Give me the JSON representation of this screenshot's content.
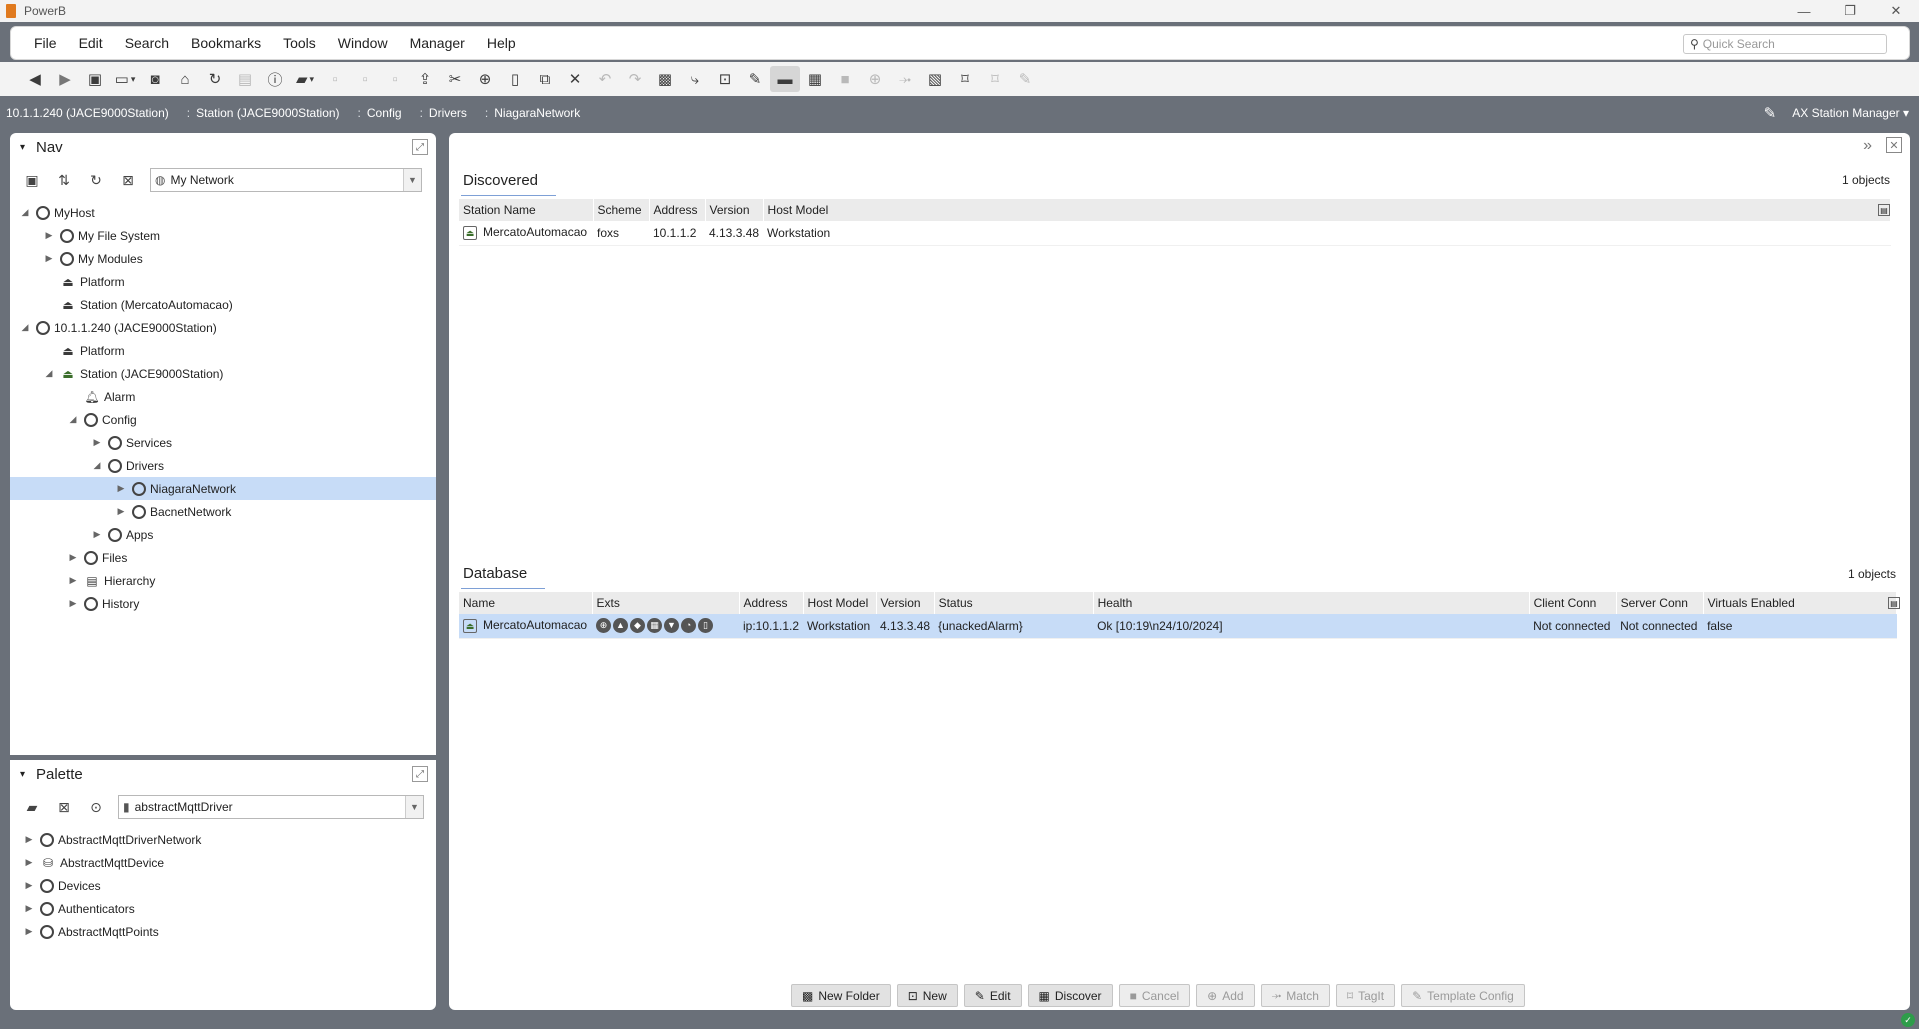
{
  "window": {
    "title": "PowerB",
    "minimize": "—",
    "restore": "❐",
    "close": "✕"
  },
  "menu": {
    "items": [
      "File",
      "Edit",
      "Search",
      "Bookmarks",
      "Tools",
      "Window",
      "Manager",
      "Help"
    ],
    "quick_search_placeholder": "Quick Search"
  },
  "pathbar": {
    "crumbs": [
      "10.1.1.240 (JACE9000Station)",
      "Station (JACE9000Station)",
      "Config",
      "Drivers",
      "NiagaraNetwork"
    ],
    "view_label": "AX Station Manager"
  },
  "nav": {
    "title": "Nav",
    "combo_value": "My Network",
    "tree": [
      {
        "label": "MyHost"
      },
      {
        "label": "My File System"
      },
      {
        "label": "My Modules"
      },
      {
        "label": "Platform"
      },
      {
        "label": "Station (MercatoAutomacao)"
      },
      {
        "label": "10.1.1.240 (JACE9000Station)"
      },
      {
        "label": "Platform"
      },
      {
        "label": "Station (JACE9000Station)"
      },
      {
        "label": "Alarm"
      },
      {
        "label": "Config"
      },
      {
        "label": "Services"
      },
      {
        "label": "Drivers"
      },
      {
        "label": "NiagaraNetwork"
      },
      {
        "label": "BacnetNetwork"
      },
      {
        "label": "Apps"
      },
      {
        "label": "Files"
      },
      {
        "label": "Hierarchy"
      },
      {
        "label": "History"
      }
    ]
  },
  "palette": {
    "title": "Palette",
    "combo_value": "abstractMqttDriver",
    "items": [
      {
        "label": "AbstractMqttDriverNetwork"
      },
      {
        "label": "AbstractMqttDevice"
      },
      {
        "label": "Devices"
      },
      {
        "label": "Authenticators"
      },
      {
        "label": "AbstractMqttPoints"
      }
    ]
  },
  "discovered": {
    "title": "Discovered",
    "count": "1 objects",
    "columns": [
      "Station Name",
      "Scheme",
      "Address",
      "Version",
      "Host Model"
    ],
    "rows": [
      [
        "MercatoAutomacao",
        "foxs",
        "10.1.1.2",
        "4.13.3.48",
        "Workstation"
      ]
    ]
  },
  "database": {
    "title": "Database",
    "count": "1 objects",
    "columns": [
      "Name",
      "Exts",
      "Address",
      "Host Model",
      "Version",
      "Status",
      "Health",
      "Client Conn",
      "Server Conn",
      "Virtuals Enabled"
    ],
    "rows": [
      [
        "MercatoAutomacao",
        "",
        "ip:10.1.1.2",
        "Workstation",
        "4.13.3.48",
        "{unackedAlarm}",
        "Ok [10:19\\n24/10/2024]",
        "Not connected",
        "Not connected",
        "false"
      ]
    ]
  },
  "buttons": {
    "new_folder": "New Folder",
    "new": "New",
    "edit": "Edit",
    "discover": "Discover",
    "cancel": "Cancel",
    "add": "Add",
    "match": "Match",
    "tagit": "TagIt",
    "template_config": "Template Config"
  }
}
